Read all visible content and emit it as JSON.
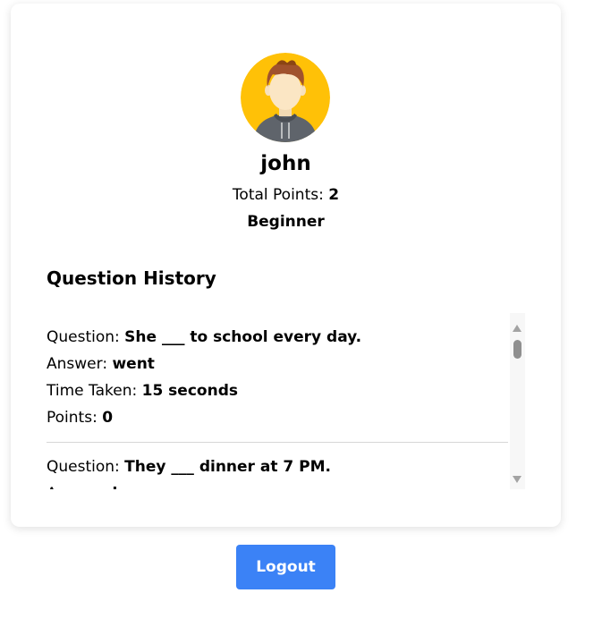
{
  "profile": {
    "username": "john",
    "points_label": "Total Points: ",
    "points_value": "2",
    "level": "Beginner"
  },
  "history": {
    "title": "Question History",
    "labels": {
      "question": "Question: ",
      "answer": "Answer: ",
      "time": "Time Taken: ",
      "points": "Points: "
    },
    "entries": [
      {
        "question": "She ___ to school every day.",
        "answer": "went",
        "time": "15 seconds",
        "points": "0"
      },
      {
        "question": "They ___ dinner at 7 PM.",
        "answer": "have"
      }
    ]
  },
  "actions": {
    "logout_label": "Logout"
  },
  "colors": {
    "avatar_bg": "#FFC107",
    "button_bg": "#3B82F6"
  },
  "icons": {
    "avatar": "user-avatar-icon"
  }
}
